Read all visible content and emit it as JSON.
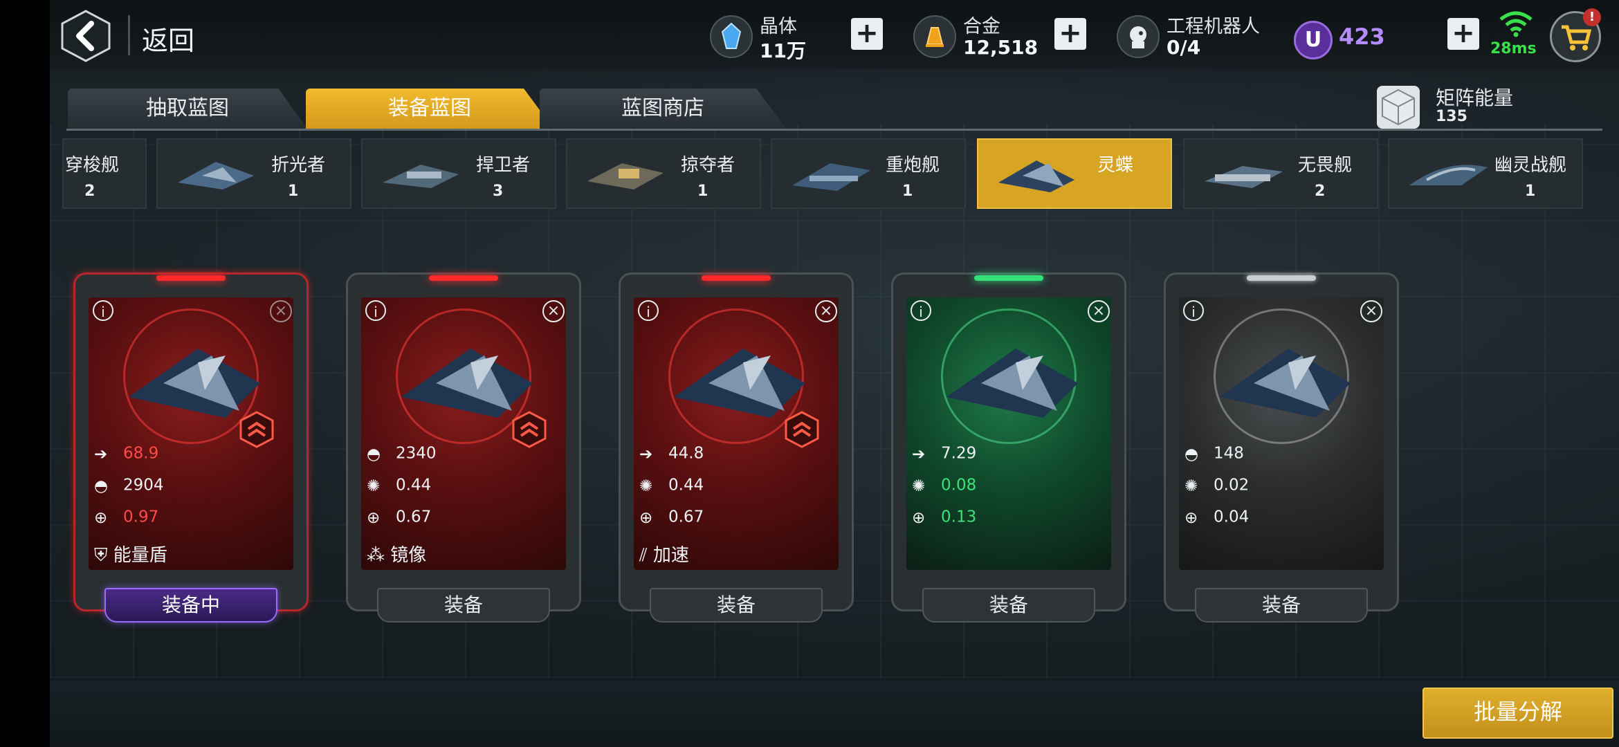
{
  "header": {
    "back_label": "返回",
    "resources": [
      {
        "name": "晶体",
        "value": "11万",
        "icon": "crystal-icon"
      },
      {
        "name": "合金",
        "value": "12,518",
        "icon": "alloy-icon"
      },
      {
        "name": "工程机器人",
        "value": "0/4",
        "icon": "robot-icon"
      }
    ],
    "premium_value": "423",
    "premium_icon_letter": "U",
    "ping": "28ms"
  },
  "tabs": [
    {
      "label": "抽取蓝图",
      "active": false
    },
    {
      "label": "装备蓝图",
      "active": true
    },
    {
      "label": "蓝图商店",
      "active": false
    }
  ],
  "matrix": {
    "label": "矩阵能量",
    "value": "135"
  },
  "ship_types": [
    {
      "name": "穿梭舰",
      "count": "2"
    },
    {
      "name": "折光者",
      "count": "1"
    },
    {
      "name": "捍卫者",
      "count": "3"
    },
    {
      "name": "掠夺者",
      "count": "1"
    },
    {
      "name": "重炮舰",
      "count": "1"
    },
    {
      "name": "灵蝶",
      "count": "",
      "selected": true
    },
    {
      "name": "无畏舰",
      "count": "2"
    },
    {
      "name": "幽灵战舰",
      "count": "1"
    }
  ],
  "cards": [
    {
      "rarity": "red",
      "stats": [
        "68.9",
        "2904",
        "0.97"
      ],
      "skill": "能量盾",
      "button": "装备中",
      "equipped": true
    },
    {
      "rarity": "red",
      "stats": [
        "2340",
        "0.44",
        "0.67"
      ],
      "skill": "镜像",
      "button": "装备"
    },
    {
      "rarity": "red",
      "stats": [
        "44.8",
        "0.44",
        "0.67"
      ],
      "skill": "加速",
      "button": "装备"
    },
    {
      "rarity": "green",
      "stats": [
        "7.29",
        "0.08",
        "0.13"
      ],
      "skill": "",
      "button": "装备"
    },
    {
      "rarity": "grey",
      "stats": [
        "148",
        "0.02",
        "0.04"
      ],
      "skill": "",
      "button": "装备"
    }
  ],
  "bulk_button": "批量分解",
  "colors": {
    "accent_gold": "#d8a424",
    "rarity_red": "#ff2a2a",
    "rarity_green": "#35e07a",
    "premium_purple": "#b58cff"
  }
}
